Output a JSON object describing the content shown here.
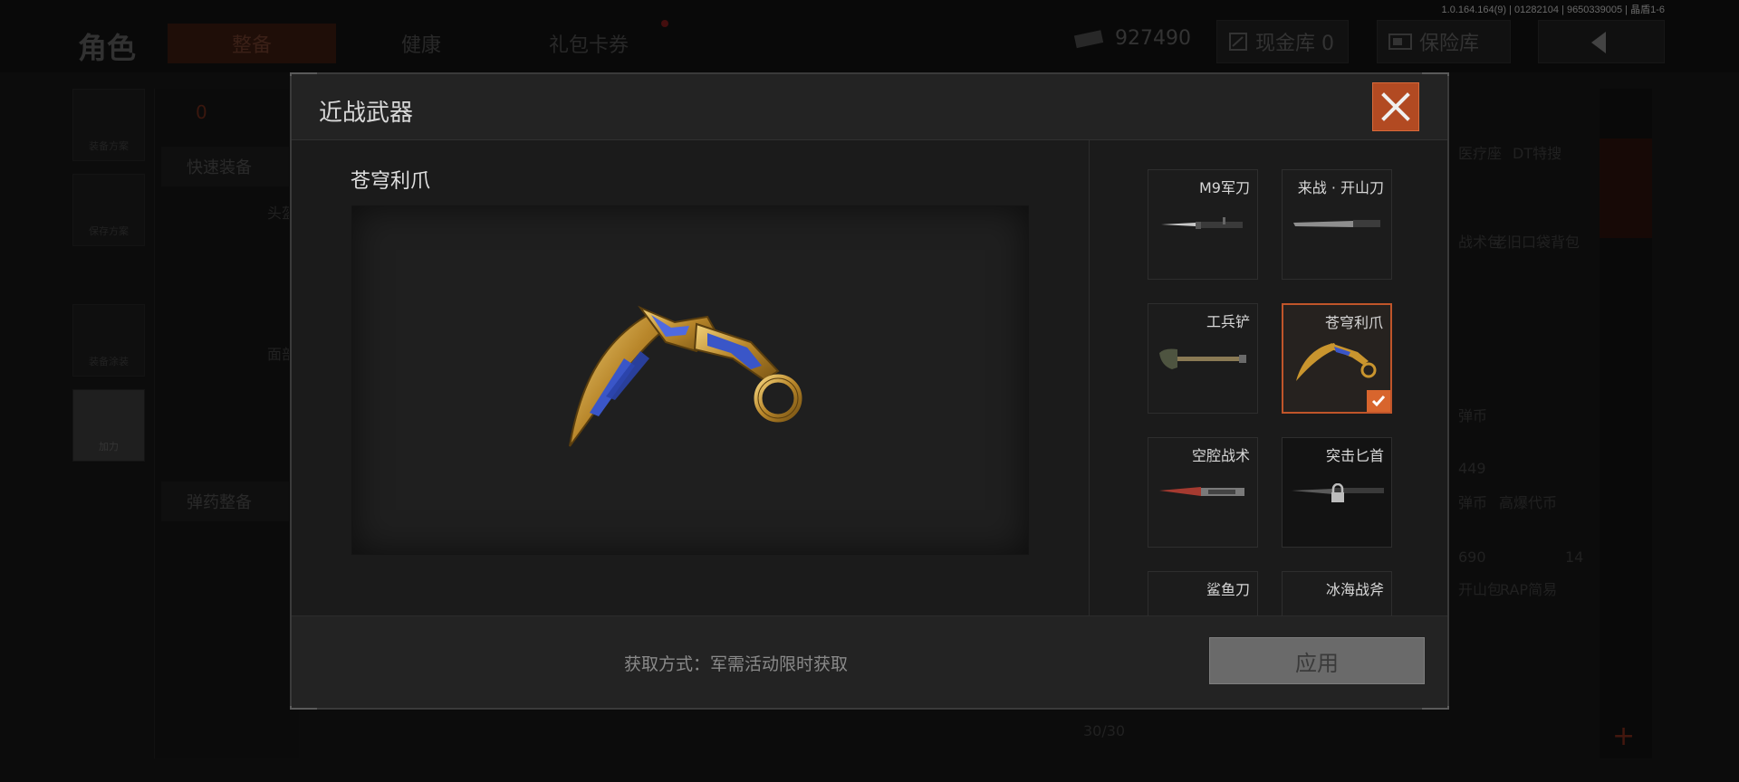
{
  "background": {
    "version_text": "1.0.164.164(9) | 01282104 | 9650339005 | 晶盾1-6",
    "page_title": "角色",
    "tabs": [
      {
        "label": "整备"
      },
      {
        "label": "健康"
      },
      {
        "label": "礼包卡券"
      }
    ],
    "currency_value": "927490",
    "cash_vault_label": "现金库 0",
    "insurance_vault_label": "保险库",
    "side_buttons": [
      {
        "label": "装备方案"
      },
      {
        "label": "保存方案"
      },
      {
        "label": "装备涂装"
      },
      {
        "label": "加力"
      }
    ],
    "left_panel": {
      "quick_equip": "快速装备",
      "ammo_equip": "弹药整备",
      "head_label": "头盔",
      "face_label": "面部",
      "badge_count": "0"
    },
    "right_panel": {
      "cells": [
        "医疗座",
        "DT特搜",
        "战术包",
        "老旧口袋背包",
        "弹币",
        "449",
        "弹币",
        "690",
        "高爆代币",
        "14",
        "开山包",
        "RAP简易",
        "30/30"
      ]
    }
  },
  "modal": {
    "title": "近战武器",
    "selected_name": "苍穹利爪",
    "acquire_text": "获取方式：军需活动限时获取",
    "apply_label": "应用",
    "weapons": [
      {
        "label": "M9军刀",
        "selected": false,
        "locked": false,
        "icon": "bayonet-icon"
      },
      {
        "label": "来战 · 开山刀",
        "selected": false,
        "locked": false,
        "icon": "machete-icon"
      },
      {
        "label": "工兵铲",
        "selected": false,
        "locked": false,
        "icon": "shovel-icon"
      },
      {
        "label": "苍穹利爪",
        "selected": true,
        "locked": false,
        "icon": "karambit-icon"
      },
      {
        "label": "空腔战术",
        "selected": false,
        "locked": false,
        "icon": "tactical-knife-icon"
      },
      {
        "label": "突击匕首",
        "selected": false,
        "locked": true,
        "icon": "dagger-icon"
      },
      {
        "label": "鲨鱼刀",
        "selected": false,
        "locked": false,
        "icon": "knife-icon"
      },
      {
        "label": "冰海战斧",
        "selected": false,
        "locked": false,
        "icon": "axe-icon"
      }
    ]
  }
}
